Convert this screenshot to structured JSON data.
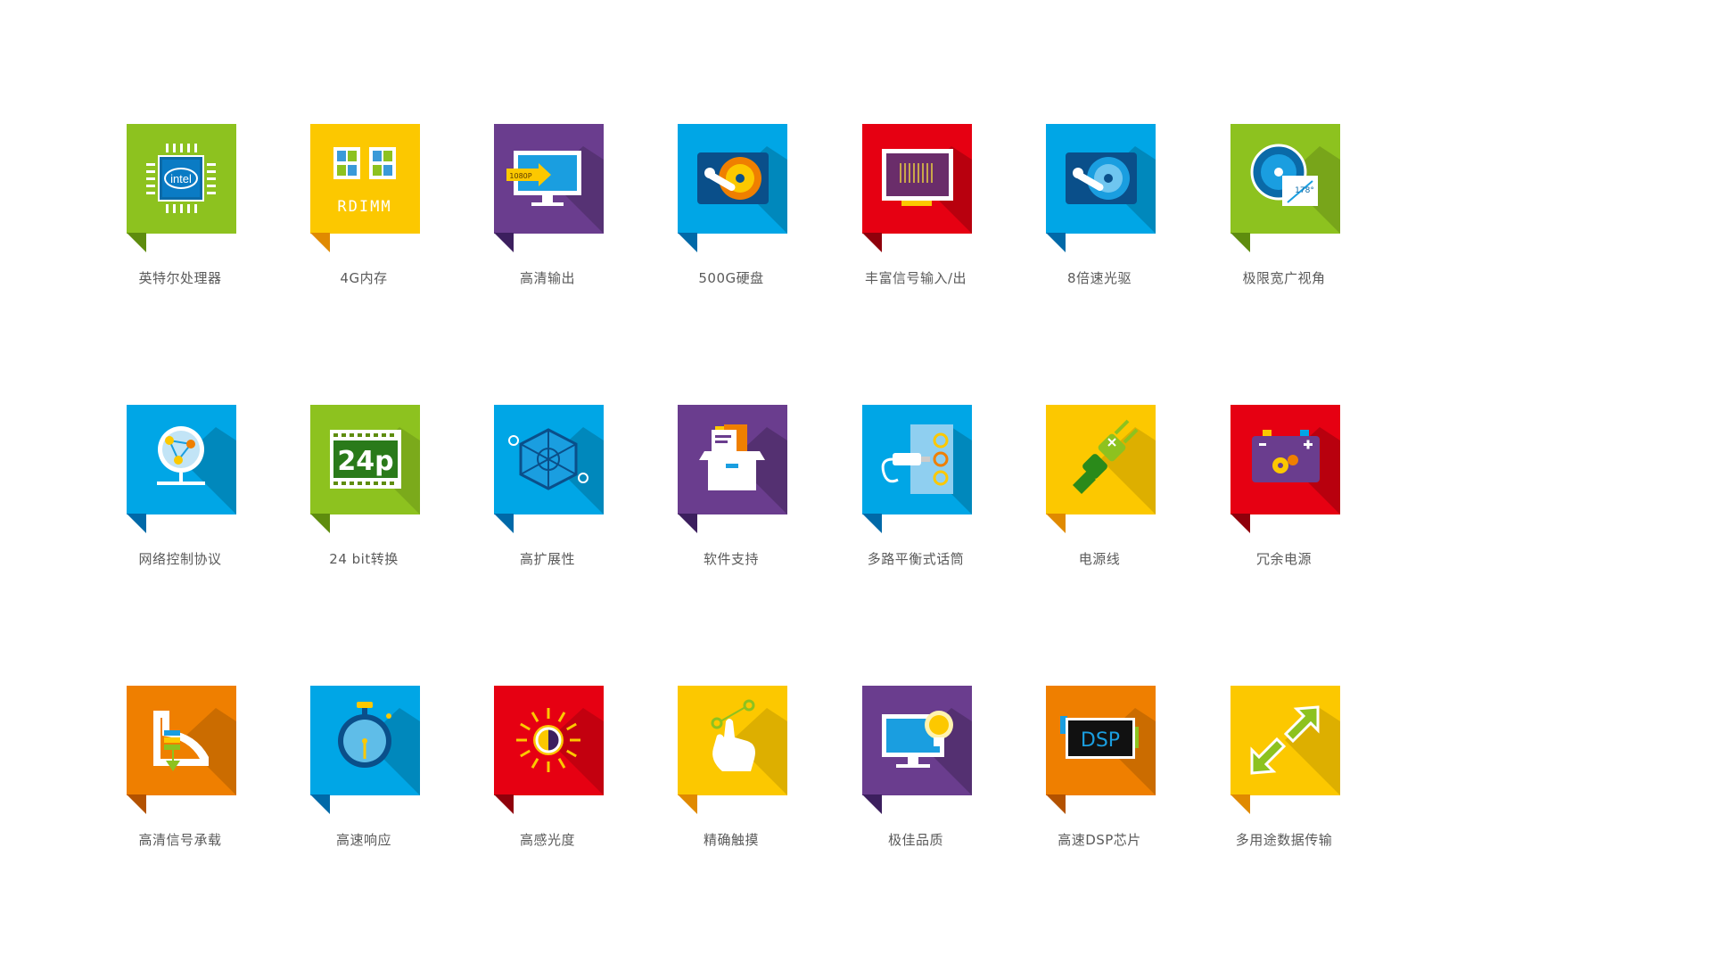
{
  "features": [
    {
      "label": "英特尔处理器",
      "icon": "cpu-icon",
      "color": "#8dc21f",
      "dark": "#5e8c0e",
      "chip_text": "intel"
    },
    {
      "label": "4G内存",
      "icon": "memory-icon",
      "color": "#fcc800",
      "dark": "#e08a00",
      "chip_text": "RDIMM"
    },
    {
      "label": "高清输出",
      "icon": "monitor-output-icon",
      "color": "#6a3d8e",
      "dark": "#3c1f5e",
      "chip_text": "1080P"
    },
    {
      "label": "500G硬盘",
      "icon": "hard-disk-icon",
      "color": "#00a6e6",
      "dark": "#0069a8"
    },
    {
      "label": "丰富信号输入/出",
      "icon": "signal-board-icon",
      "color": "#e60012",
      "dark": "#8f000b"
    },
    {
      "label": "8倍速光驱",
      "icon": "optical-drive-icon",
      "color": "#00a6e6",
      "dark": "#0069a8"
    },
    {
      "label": "极限宽广视角",
      "icon": "viewing-angle-icon",
      "color": "#8dc21f",
      "dark": "#5e8c0e",
      "chip_text": "178°"
    },
    {
      "label": "网络控制协议",
      "icon": "network-globe-icon",
      "color": "#00a6e6",
      "dark": "#0069a8"
    },
    {
      "label": "24 bit转换",
      "icon": "film-24p-icon",
      "color": "#8dc21f",
      "dark": "#5e8c0e",
      "chip_text": "24p"
    },
    {
      "label": "高扩展性",
      "icon": "network-cube-icon",
      "color": "#00a6e6",
      "dark": "#0069a8"
    },
    {
      "label": "软件支持",
      "icon": "software-box-icon",
      "color": "#6a3d8e",
      "dark": "#3c1f5e"
    },
    {
      "label": "多路平衡式话筒",
      "icon": "microphone-jack-icon",
      "color": "#00a6e6",
      "dark": "#0069a8"
    },
    {
      "label": "电源线",
      "icon": "power-plug-icon",
      "color": "#fcc800",
      "dark": "#e08a00"
    },
    {
      "label": "冗余电源",
      "icon": "battery-icon",
      "color": "#e60012",
      "dark": "#8f000b"
    },
    {
      "label": "高清信号承载",
      "icon": "signal-carry-icon",
      "color": "#ef7f00",
      "dark": "#b35200"
    },
    {
      "label": "高速响应",
      "icon": "stopwatch-icon",
      "color": "#00a6e6",
      "dark": "#0069a8"
    },
    {
      "label": "高感光度",
      "icon": "sun-icon",
      "color": "#e60012",
      "dark": "#8f000b"
    },
    {
      "label": "精确触摸",
      "icon": "touch-hand-icon",
      "color": "#fcc800",
      "dark": "#e08a00"
    },
    {
      "label": "极佳品质",
      "icon": "monitor-bulb-icon",
      "color": "#6a3d8e",
      "dark": "#3c1f5e"
    },
    {
      "label": "高速DSP芯片",
      "icon": "dsp-chip-icon",
      "color": "#ef7f00",
      "dark": "#b35200",
      "chip_text": "DSP"
    },
    {
      "label": "多用途数据传输",
      "icon": "transfer-arrows-icon",
      "color": "#fcc800",
      "dark": "#e08a00"
    }
  ]
}
